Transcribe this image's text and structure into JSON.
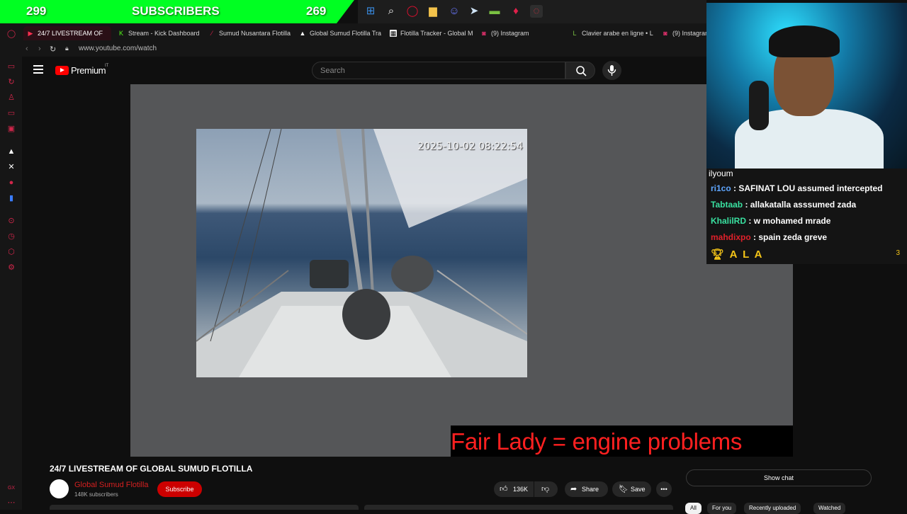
{
  "overlay": {
    "sub_current": "299",
    "sub_label": "SUBSCRIBERS",
    "sub_goal": "269",
    "colors": {
      "sub_bar": "#00ff22"
    }
  },
  "taskbar": {
    "icons": [
      "windows-icon",
      "search-icon",
      "opera-icon",
      "folder-icon",
      "discord-icon",
      "steam-icon",
      "nvidia-icon",
      "maps-pin-icon",
      "opera-gx-icon"
    ]
  },
  "tabs": [
    {
      "label": "24/7 LIVESTREAM OF",
      "icon": "youtube-icon",
      "active": true
    },
    {
      "label": "Stream - Kick Dashboard",
      "icon": "kick-icon",
      "active": false
    },
    {
      "label": "Sumud Nusantara Flotilla",
      "icon": "flotilla-icon",
      "active": false
    },
    {
      "label": "Global Sumud Flotilla Tra",
      "icon": "global-icon",
      "active": false
    },
    {
      "label": "Flotilla Tracker - Global M",
      "icon": "tracker-icon",
      "active": false
    },
    {
      "label": "(9) Instagram",
      "icon": "instagram-icon",
      "active": false
    },
    {
      "label": "Clavier arabe en ligne • L",
      "icon": "keyboard-icon",
      "active": false
    },
    {
      "label": "(9) Instagram",
      "icon": "instagram-icon",
      "active": false
    }
  ],
  "address": {
    "url": "www.youtube.com/watch"
  },
  "youtube": {
    "brand": "Premium",
    "region": "IT",
    "search_placeholder": "Search"
  },
  "player": {
    "timestamp": "2025-10-02 08:22:54",
    "caption": "Fair Lady = engine problems"
  },
  "chat": {
    "top_partial": "ilyoum",
    "messages": [
      {
        "user": "ri1co",
        "text": ": SAFINAT LOU assumed intercepted",
        "color": "#5fa6ff"
      },
      {
        "user": "Tabtaab",
        "text": ": allakatalla asssumed zada",
        "color": "#39e0a0"
      },
      {
        "user": "KhalilRD",
        "text": ": w mohamed mrade",
        "color": "#39e0a0"
      },
      {
        "user": "mahdixpo",
        "text": ": spain zeda greve",
        "color": "#e0202a"
      }
    ],
    "alert_name": "A L A",
    "alert_count": "3"
  },
  "video": {
    "title": "24/7 LIVESTREAM OF GLOBAL SUMUD FLOTILLA",
    "channel": "Global Sumud Flotilla",
    "subscribers": "148K subscribers",
    "subscribe_label": "Subscribe",
    "likes": "136K",
    "share_label": "Share",
    "save_label": "Save",
    "show_chat_label": "Show chat"
  },
  "chips": [
    "All",
    "For you",
    "Recently uploaded",
    "Watched"
  ]
}
